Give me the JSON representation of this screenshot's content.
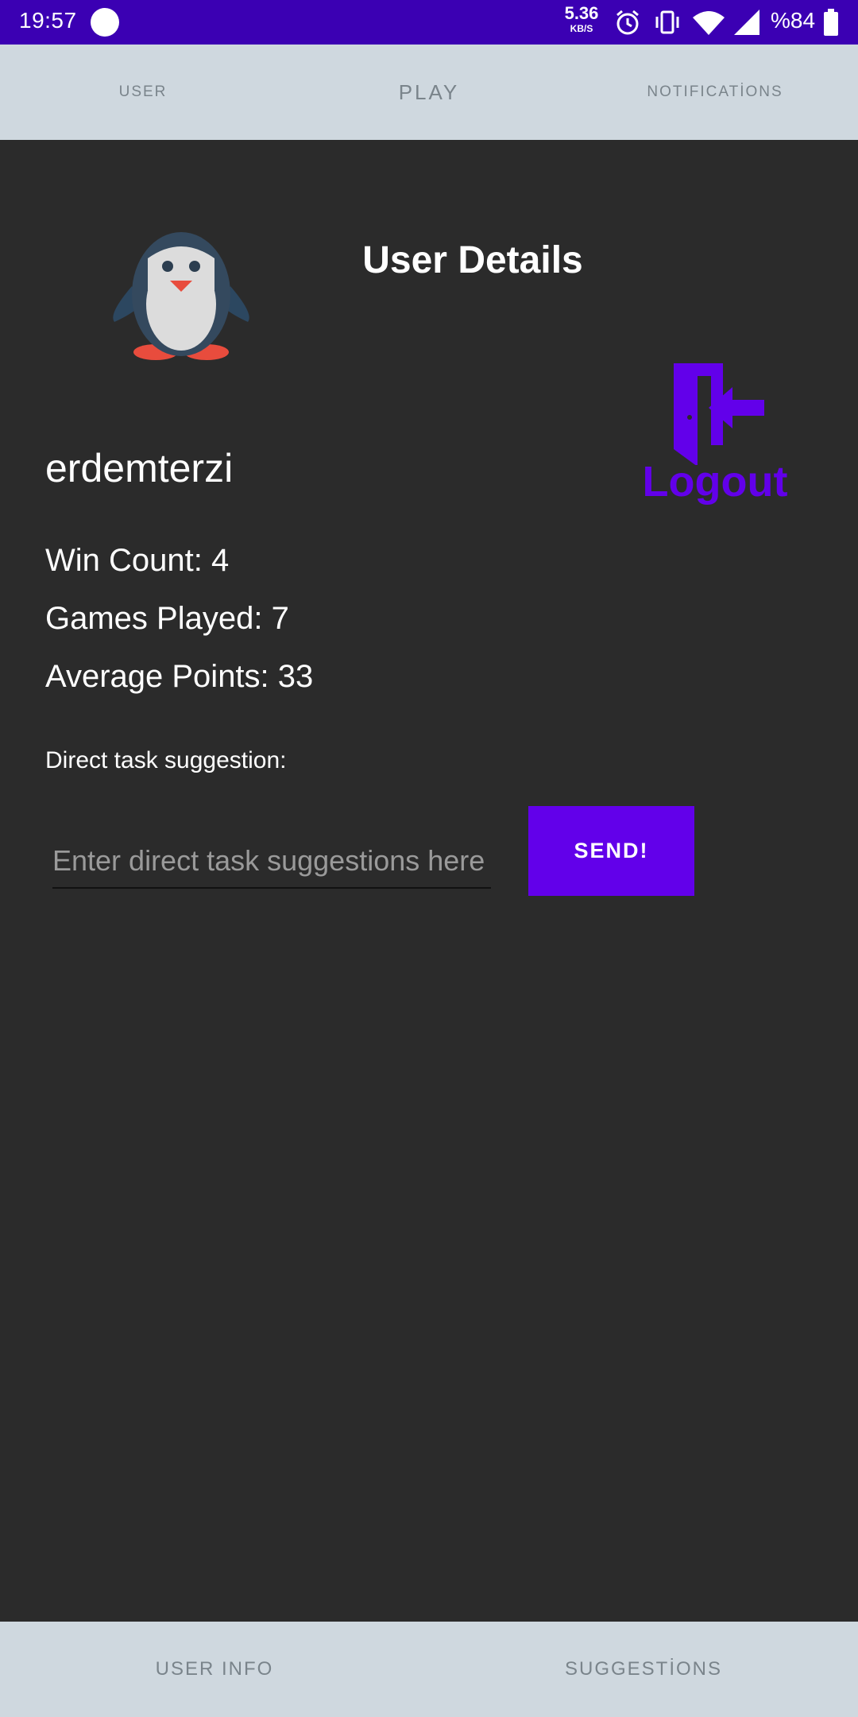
{
  "status_bar": {
    "time": "19:57",
    "net_speed_value": "5.36",
    "net_speed_unit": "KB/S",
    "battery": "%84",
    "icons": [
      "record-dot-icon",
      "alarm-icon",
      "vibrate-icon",
      "wifi-icon",
      "signal-icon",
      "battery-icon"
    ],
    "background_color": "#3b00b3"
  },
  "top_tabs": {
    "user": "USER",
    "play": "PLAY",
    "notifications": "NOTIFICATİONS"
  },
  "main": {
    "title": "User Details",
    "avatar_icon": "penguin-icon",
    "logout_icon": "door-exit-icon",
    "logout_label": "Logout",
    "username": "erdemterzi",
    "win_count": "Win Count: 4",
    "games_played": "Games Played: 7",
    "average_points": "Average Points: 33",
    "suggestion_label": "Direct task suggestion:",
    "suggestion_placeholder": "Enter direct task suggestions here",
    "send_label": "SEND!",
    "accent_color": "#6200ea"
  },
  "bottom_tabs": {
    "user_info": "USER INFO",
    "suggestions": "SUGGESTİONS"
  }
}
